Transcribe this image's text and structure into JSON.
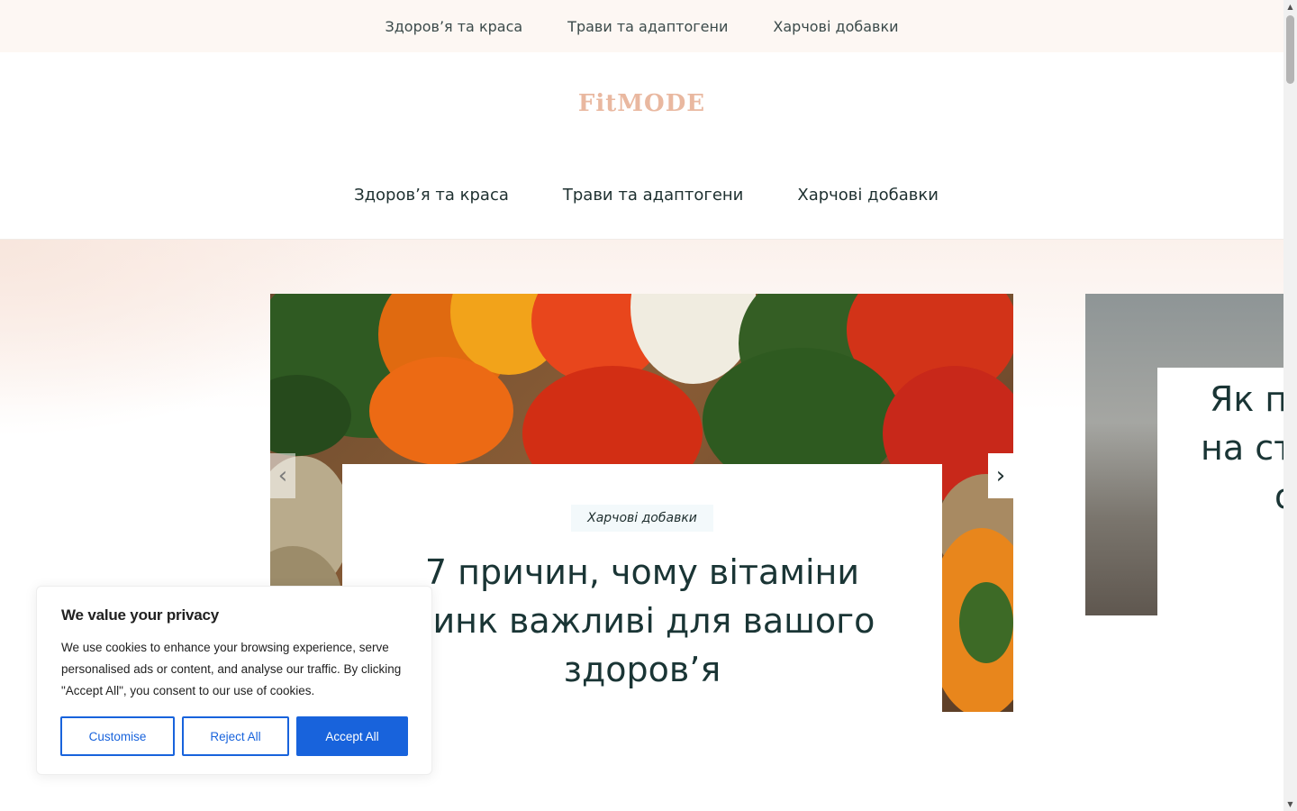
{
  "topbar": {
    "items": [
      "Здоров’я та краса",
      "Трави та адаптогени",
      "Харчові добавки"
    ]
  },
  "logo": "FitMODE",
  "mainnav": {
    "items": [
      "Здоров’я та краса",
      "Трави та адаптогени",
      "Харчові добавки"
    ]
  },
  "slider": {
    "slides": [
      {
        "category": "Харчові добавки",
        "title": "7 причин, чому вітаміни цинк важливі для вашого здоров’я"
      },
      {
        "title": "Як п на ст о"
      }
    ],
    "prev_icon": "‹",
    "next_icon": "›"
  },
  "cookie": {
    "title": "We value your privacy",
    "text": "We use cookies to enhance your browsing experience, serve personalised ads or content, and analyse our traffic. By clicking \"Accept All\", you consent to our use of cookies.",
    "customise": "Customise",
    "reject": "Reject All",
    "accept": "Accept All"
  },
  "colors": {
    "brand": "#e9b8a0",
    "accent": "#1863dc"
  }
}
